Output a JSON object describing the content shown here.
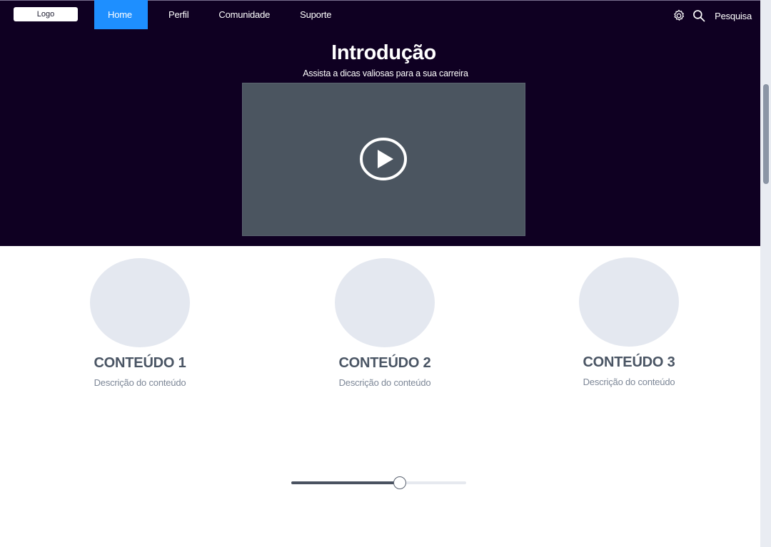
{
  "header": {
    "logo_label": "Logo",
    "nav": [
      {
        "label": "Home",
        "active": true
      },
      {
        "label": "Perfil",
        "active": false
      },
      {
        "label": "Comunidade",
        "active": false
      },
      {
        "label": "Suporte",
        "active": false
      }
    ],
    "settings_icon": "gear-icon",
    "search_icon": "search-icon",
    "search_label": "Pesquisa"
  },
  "hero": {
    "title": "Introdução",
    "subtitle": "Assista a dicas valiosas para a sua carreira",
    "video_icon": "play-icon"
  },
  "cards": [
    {
      "title": "CONTEÚDO 1",
      "description": "Descrição do conteúdo"
    },
    {
      "title": "CONTEÚDO 2",
      "description": "Descrição do conteúdo"
    },
    {
      "title": "CONTEÚDO 3",
      "description": "Descrição do conteúdo"
    }
  ],
  "slider": {
    "value_percent": 62
  },
  "scrollbar": {
    "position_percent": 15
  },
  "colors": {
    "hero_bg": "#0f0022",
    "nav_active": "#1e8fff",
    "video_bg": "#4b5560",
    "card_circle": "#e4e8f0",
    "card_title": "#4a5564",
    "card_desc": "#7d8797"
  }
}
